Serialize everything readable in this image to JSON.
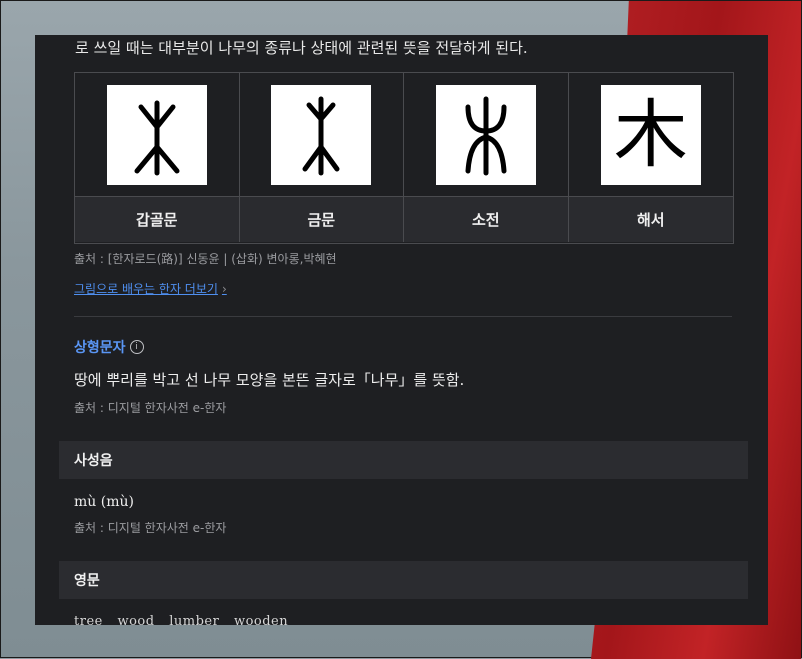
{
  "intro_text": "로 쓰일 때는 대부분이 나무의 종류나 상태에 관련된 뜻을 전달하게 된다.",
  "glyph_table": {
    "scripts": [
      {
        "label": "갑골문",
        "icon": "oracle-bone-glyph"
      },
      {
        "label": "금문",
        "icon": "bronze-script-glyph"
      },
      {
        "label": "소전",
        "icon": "small-seal-glyph"
      },
      {
        "label": "해서",
        "icon": "regular-script-glyph"
      }
    ],
    "regular_char": "木"
  },
  "source_images": "출처 : [한자로드(路)] 신동윤 | (삽화) 변아롱,박혜현",
  "more_link": "그림으로 배우는 한자 더보기",
  "formation": {
    "type": "상형문자",
    "info_icon": "ⓘ",
    "meaning": "땅에 뿌리를 박고 선 나무 모양을 본뜬 글자로「나무」를 뜻함.",
    "source": "출처 : 디지털 한자사전 e-한자"
  },
  "pronunciation": {
    "heading": "사성음",
    "reading": "mù (mù)",
    "source": "출처 : 디지털 한자사전 e-한자"
  },
  "english": {
    "heading": "영문",
    "words": [
      "tree",
      "wood",
      "lumber",
      "wooden"
    ]
  },
  "colors": {
    "panel": "#1e1f22",
    "link": "#4f8ff0",
    "accent": "#5a96f5"
  }
}
